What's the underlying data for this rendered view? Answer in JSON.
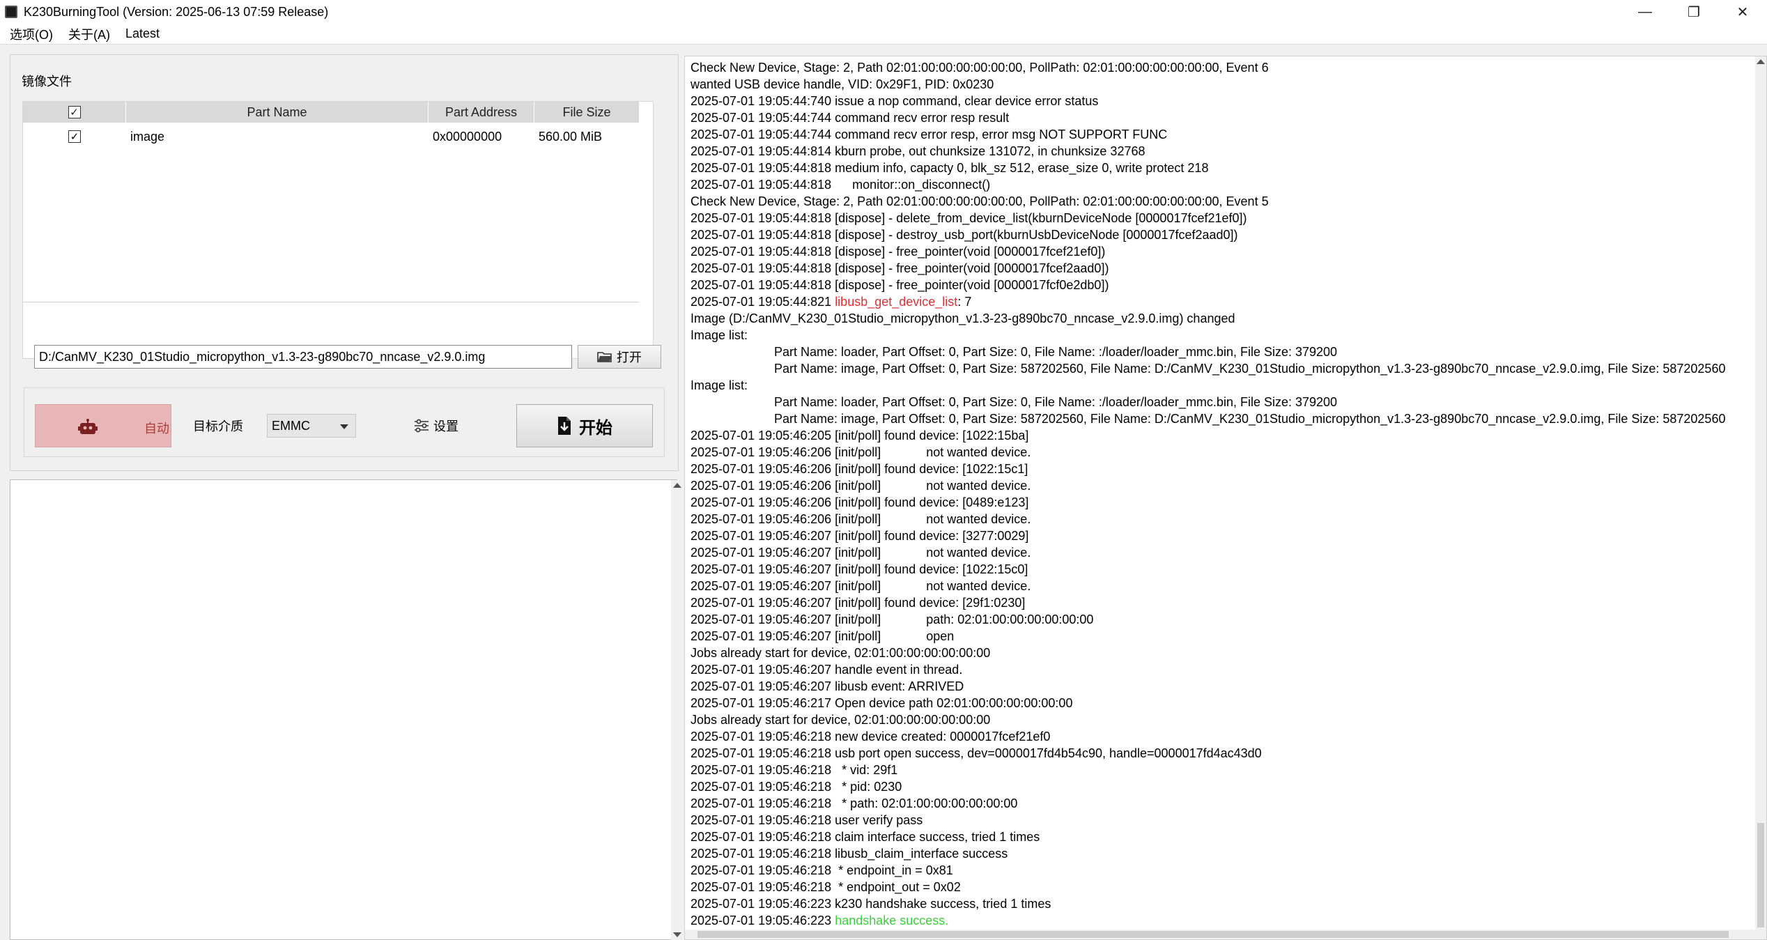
{
  "window": {
    "title": "K230BurningTool (Version: 2025-06-13 07:59 Release)",
    "minimize": "—",
    "maximize": "❐",
    "close": "✕"
  },
  "menu": {
    "items": [
      "选项(O)",
      "关于(A)",
      "Latest"
    ]
  },
  "image_group": {
    "label": "镜像文件",
    "columns": [
      "Part Name",
      "Part Address",
      "File Size"
    ],
    "rows": [
      {
        "checked": true,
        "name": "image",
        "address": "0x00000000",
        "size": "560.00 MiB"
      }
    ],
    "path": "D:/CanMV_K230_01Studio_micropython_v1.3-23-g890bc70_nncase_v2.9.0.img",
    "open_label": "打开"
  },
  "controls": {
    "auto_label": "自动",
    "target_label": "目标介质",
    "medium": "EMMC",
    "settings_label": "设置",
    "start_label": "开始"
  },
  "colors": {
    "error": "#e03030",
    "success": "#3ccf3c",
    "auto_bg": "#e9b6b8"
  },
  "log": [
    {
      "text": "Check New Device, Stage: 2, Path 02:01:00:00:00:00:00:00, PollPath: 02:01:00:00:00:00:00:00, Event 6"
    },
    {
      "text": "wanted USB device handle, VID: 0x29F1, PID: 0x0230"
    },
    {
      "text": "2025-07-01 19:05:44:740 issue a nop command, clear device error status"
    },
    {
      "text": "2025-07-01 19:05:44:744 command recv error resp result"
    },
    {
      "text": "2025-07-01 19:05:44:744 command recv error resp, error msg NOT SUPPORT FUNC"
    },
    {
      "text": "2025-07-01 19:05:44:814 kburn probe, out chunksize 131072, in chunksize 32768"
    },
    {
      "text": "2025-07-01 19:05:44:818 medium info, capacty 0, blk_sz 512, erase_size 0, write protect 218"
    },
    {
      "text": "2025-07-01 19:05:44:818      monitor::on_disconnect()"
    },
    {
      "text": "Check New Device, Stage: 2, Path 02:01:00:00:00:00:00:00, PollPath: 02:01:00:00:00:00:00:00, Event 5"
    },
    {
      "text": "2025-07-01 19:05:44:818 [dispose] - delete_from_device_list(kburnDeviceNode [0000017fcef21ef0])"
    },
    {
      "text": "2025-07-01 19:05:44:818 [dispose] - destroy_usb_port(kburnUsbDeviceNode [0000017fcef2aad0])"
    },
    {
      "text": "2025-07-01 19:05:44:818 [dispose] - free_pointer(void [0000017fcef21ef0])"
    },
    {
      "text": "2025-07-01 19:05:44:818 [dispose] - free_pointer(void [0000017fcef2aad0])"
    },
    {
      "text": "2025-07-01 19:05:44:818 [dispose] - free_pointer(void [0000017fcf0e2db0])"
    },
    {
      "text": "2025-07-01 19:05:44:821 ",
      "hl": "libusb_get_device_list",
      "hlc": "red",
      "tail": ": 7"
    },
    {
      "text": "Image (D:/CanMV_K230_01Studio_micropython_v1.3-23-g890bc70_nncase_v2.9.0.img) changed"
    },
    {
      "text": "Image list:"
    },
    {
      "text": "Part Name: loader, Part Offset: 0, Part Size: 0, File Name: :/loader/loader_mmc.bin, File Size: 379200",
      "indent": true
    },
    {
      "text": "Part Name: image, Part Offset: 0, Part Size: 587202560, File Name: D:/CanMV_K230_01Studio_micropython_v1.3-23-g890bc70_nncase_v2.9.0.img, File Size: 587202560",
      "indent": true
    },
    {
      "text": "Image list:"
    },
    {
      "text": "Part Name: loader, Part Offset: 0, Part Size: 0, File Name: :/loader/loader_mmc.bin, File Size: 379200",
      "indent": true
    },
    {
      "text": "Part Name: image, Part Offset: 0, Part Size: 587202560, File Name: D:/CanMV_K230_01Studio_micropython_v1.3-23-g890bc70_nncase_v2.9.0.img, File Size: 587202560",
      "indent": true
    },
    {
      "text": "2025-07-01 19:05:46:205 [init/poll] found device: [1022:15ba]"
    },
    {
      "text": "2025-07-01 19:05:46:206 [init/poll]             not wanted device."
    },
    {
      "text": "2025-07-01 19:05:46:206 [init/poll] found device: [1022:15c1]"
    },
    {
      "text": "2025-07-01 19:05:46:206 [init/poll]             not wanted device."
    },
    {
      "text": "2025-07-01 19:05:46:206 [init/poll] found device: [0489:e123]"
    },
    {
      "text": "2025-07-01 19:05:46:206 [init/poll]             not wanted device."
    },
    {
      "text": "2025-07-01 19:05:46:207 [init/poll] found device: [3277:0029]"
    },
    {
      "text": "2025-07-01 19:05:46:207 [init/poll]             not wanted device."
    },
    {
      "text": "2025-07-01 19:05:46:207 [init/poll] found device: [1022:15c0]"
    },
    {
      "text": "2025-07-01 19:05:46:207 [init/poll]             not wanted device."
    },
    {
      "text": "2025-07-01 19:05:46:207 [init/poll] found device: [29f1:0230]"
    },
    {
      "text": "2025-07-01 19:05:46:207 [init/poll]             path: 02:01:00:00:00:00:00:00"
    },
    {
      "text": "2025-07-01 19:05:46:207 [init/poll]             open"
    },
    {
      "text": "Jobs already start for device, 02:01:00:00:00:00:00:00"
    },
    {
      "text": "2025-07-01 19:05:46:207 handle event in thread."
    },
    {
      "text": "2025-07-01 19:05:46:207 libusb event: ARRIVED"
    },
    {
      "text": "2025-07-01 19:05:46:217 Open device path 02:01:00:00:00:00:00:00"
    },
    {
      "text": "Jobs already start for device, 02:01:00:00:00:00:00:00"
    },
    {
      "text": "2025-07-01 19:05:46:218 new device created: 0000017fcef21ef0"
    },
    {
      "text": "2025-07-01 19:05:46:218 usb port open success, dev=0000017fd4b54c90, handle=0000017fd4ac43d0"
    },
    {
      "text": "2025-07-01 19:05:46:218   * vid: 29f1"
    },
    {
      "text": "2025-07-01 19:05:46:218   * pid: 0230"
    },
    {
      "text": "2025-07-01 19:05:46:218   * path: 02:01:00:00:00:00:00:00"
    },
    {
      "text": "2025-07-01 19:05:46:218 user verify pass"
    },
    {
      "text": "2025-07-01 19:05:46:218 claim interface success, tried 1 times"
    },
    {
      "text": "2025-07-01 19:05:46:218 libusb_claim_interface success"
    },
    {
      "text": "2025-07-01 19:05:46:218  * endpoint_in = 0x81"
    },
    {
      "text": "2025-07-01 19:05:46:218  * endpoint_out = 0x02"
    },
    {
      "text": "2025-07-01 19:05:46:223 k230 handshake success, tried 1 times"
    },
    {
      "text": "2025-07-01 19:05:46:223 ",
      "hl": "handshake success.",
      "hlc": "green",
      "tail": ""
    }
  ]
}
